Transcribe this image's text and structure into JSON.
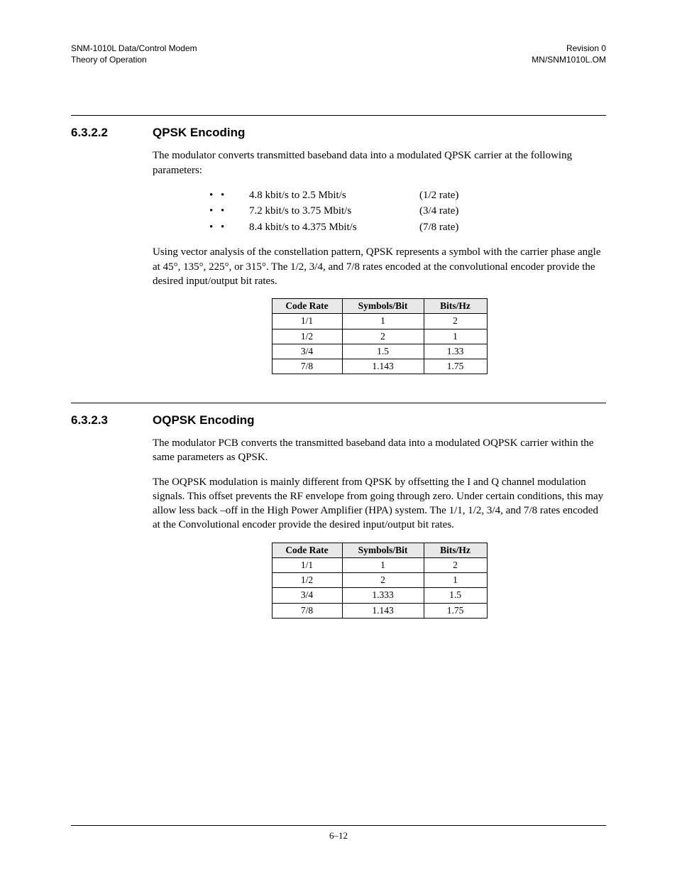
{
  "header": {
    "left1": "SNM-1010L Data/Control Modem",
    "left2": "Theory of Operation",
    "right1": "Revision 0",
    "right2": "MN/SNM1010L.OM"
  },
  "section1": {
    "number": "6.3.2.2",
    "title": "QPSK Encoding",
    "intro": "The modulator converts transmitted baseband data into a modulated QPSK carrier at the following parameters:",
    "bullets": [
      {
        "text": "4.8 kbit/s to 2.5 Mbit/s",
        "rate": "(1/2 rate)"
      },
      {
        "text": "7.2 kbit/s to 3.75 Mbit/s",
        "rate": "(3/4 rate)"
      },
      {
        "text": "8.4 kbit/s to 4.375 Mbit/s",
        "rate": "(7/8 rate)"
      }
    ],
    "para2": "Using vector analysis of the constellation pattern, QPSK represents a symbol with the carrier phase angle at 45°, 135°, 225°, or 315°. The 1/2, 3/4, and 7/8 rates encoded at the convolutional encoder provide the desired input/output bit rates.",
    "table": {
      "h1": "Code Rate",
      "h2": "Symbols/Bit",
      "h3": "Bits/Hz",
      "rows": [
        {
          "c1": "1/1",
          "c2": "1",
          "c3": "2"
        },
        {
          "c1": "1/2",
          "c2": "2",
          "c3": "1"
        },
        {
          "c1": "3/4",
          "c2": "1.5",
          "c3": "1.33"
        },
        {
          "c1": "7/8",
          "c2": "1.143",
          "c3": "1.75"
        }
      ]
    }
  },
  "section2": {
    "number": "6.3.2.3",
    "title": "OQPSK Encoding",
    "para1": "The modulator PCB converts the transmitted baseband data into a modulated OQPSK carrier within the same parameters as QPSK.",
    "para2": "The OQPSK modulation is mainly different from QPSK by offsetting the I and Q channel modulation signals. This offset prevents the RF envelope from going through zero. Under certain conditions, this may allow less back –off in the High Power Amplifier (HPA) system. The 1/1, 1/2, 3/4, and 7/8 rates encoded at the  Convolutional encoder provide the desired input/output bit rates.",
    "table": {
      "h1": "Code Rate",
      "h2": "Symbols/Bit",
      "h3": "Bits/Hz",
      "rows": [
        {
          "c1": "1/1",
          "c2": "1",
          "c3": "2"
        },
        {
          "c1": "1/2",
          "c2": "2",
          "c3": "1"
        },
        {
          "c1": "3/4",
          "c2": "1.333",
          "c3": "1.5"
        },
        {
          "c1": "7/8",
          "c2": "1.143",
          "c3": "1.75"
        }
      ]
    }
  },
  "footer": {
    "pageNumber": "6–12"
  }
}
